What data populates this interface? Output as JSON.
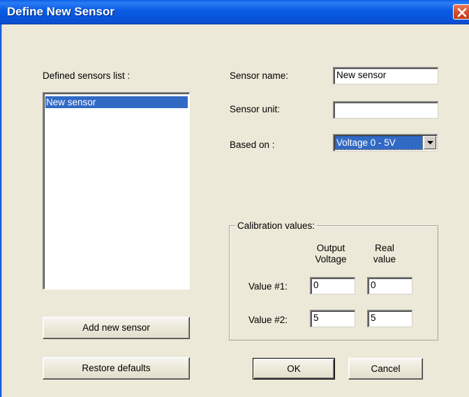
{
  "window": {
    "title": "Define New Sensor"
  },
  "sensors": {
    "list_label": "Defined sensors list :",
    "items": [
      "New sensor"
    ],
    "selected_index": 0
  },
  "form": {
    "name_label": "Sensor name:",
    "name_value": "New sensor",
    "unit_label": "Sensor unit:",
    "unit_value": "",
    "based_on_label": "Based on :",
    "based_on_value": "Voltage 0 - 5V"
  },
  "calibration": {
    "title": "Calibration values:",
    "col_output": [
      "Output",
      "Voltage"
    ],
    "col_real": [
      "Real",
      "value"
    ],
    "rows": [
      {
        "label": "Value #1:",
        "output": "0",
        "real": "0"
      },
      {
        "label": "Value #2:",
        "output": "5",
        "real": "5"
      }
    ]
  },
  "buttons": {
    "add": "Add new sensor",
    "restore": "Restore defaults",
    "ok": "OK",
    "cancel": "Cancel"
  },
  "icons": {
    "close": "close-icon",
    "dropdown": "chevron-down-icon"
  },
  "colors": {
    "titlebar": "#0a5fe8",
    "selection": "#316ac5",
    "dialog_bg": "#ece9d8",
    "close_button": "#d8502c"
  }
}
